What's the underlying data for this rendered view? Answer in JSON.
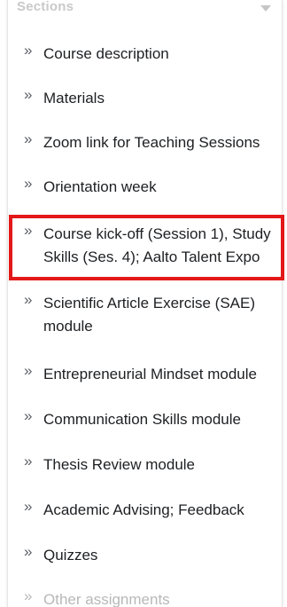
{
  "header": {
    "title": "Sections"
  },
  "sections": [
    {
      "label": "Course description"
    },
    {
      "label": "Materials"
    },
    {
      "label": "Zoom link for Teaching Sessions"
    },
    {
      "label": "Orientation week"
    },
    {
      "label": "Course kick-off (Session 1), Study Skills (Ses. 4); Aalto Talent Expo"
    },
    {
      "label": "Scientific Article Exercise (SAE) module"
    },
    {
      "label": "Entrepreneurial Mindset module"
    },
    {
      "label": "Communication Skills module"
    },
    {
      "label": "Thesis Review module"
    },
    {
      "label": "Academic Advising; Feedback"
    },
    {
      "label": "Quizzes"
    },
    {
      "label": "Other assignments"
    }
  ],
  "icons": {
    "item_icon": "double-chevron-right-icon",
    "header_icon": "chevron-down-icon"
  },
  "colors": {
    "highlight_border": "#e31818",
    "text": "#1d1f22",
    "faded_text": "#b8b8b8"
  }
}
